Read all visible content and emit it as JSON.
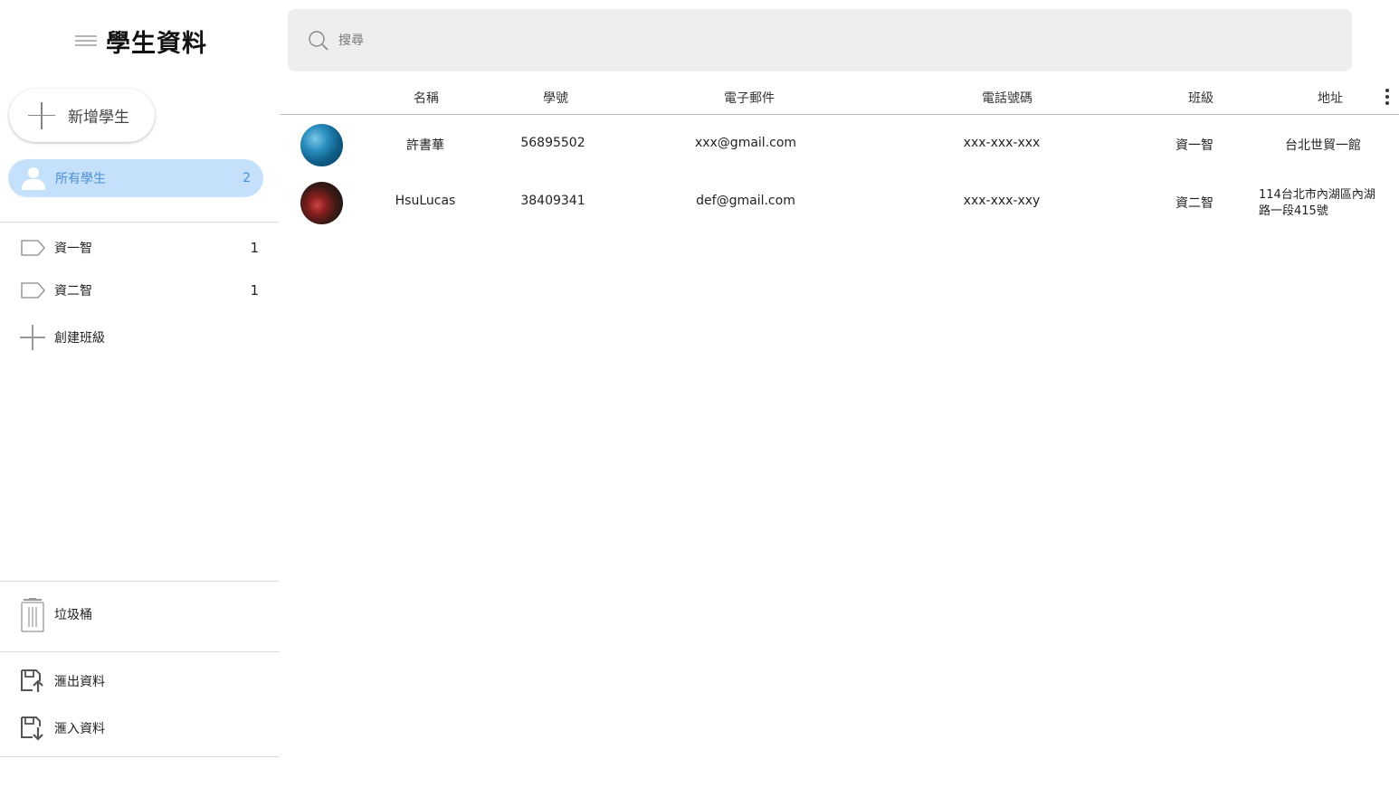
{
  "app": {
    "title": "學生資料"
  },
  "sidebar": {
    "add_button_label": "新增學生",
    "all_students": {
      "label": "所有學生",
      "count": "2"
    },
    "classes": [
      {
        "label": "資一智",
        "count": "1"
      },
      {
        "label": "資二智",
        "count": "1"
      }
    ],
    "create_class_label": "創建班級",
    "trash_label": "垃圾桶",
    "export_label": "滙出資料",
    "import_label": "滙入資料",
    "accent_color": "#c5e0fb",
    "accent_text_color": "#4d8fd6"
  },
  "search": {
    "placeholder": "搜尋",
    "value": ""
  },
  "table": {
    "headers": {
      "name": "名稱",
      "id": "學號",
      "email": "電子郵件",
      "phone": "電話號碼",
      "class": "班級",
      "address": "地址"
    },
    "rows": [
      {
        "name": "許書華",
        "id": "56895502",
        "email": "xxx@gmail.com",
        "phone": "xxx-xxx-xxx",
        "class": "資一智",
        "address": "台北世貿一館"
      },
      {
        "name": "HsuLucas",
        "id": "38409341",
        "email": "def@gmail.com",
        "phone": "xxx-xxx-xxy",
        "class": "資二智",
        "address": "114台北市內湖區內湖路一段415號"
      }
    ]
  },
  "icons": {
    "menu": "hamburger-icon",
    "add": "plus-icon",
    "person": "person-icon",
    "tag": "tag-icon",
    "trash": "trash-icon",
    "export": "export-icon",
    "import": "import-icon",
    "search": "search-icon",
    "more": "more-vertical-icon"
  }
}
